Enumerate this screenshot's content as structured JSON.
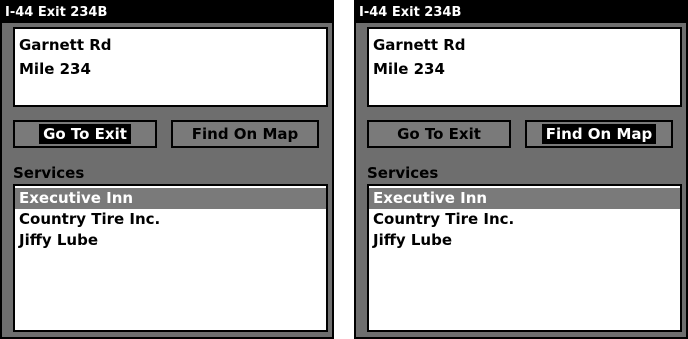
{
  "screens": [
    {
      "title": "I-44 Exit 234B",
      "address_lines": [
        "Garnett Rd",
        "Mile 234"
      ],
      "buttons": {
        "goto_label": "Go To Exit",
        "find_label": "Find On Map",
        "selected": "goto"
      },
      "services_label": "Services",
      "services": [
        "Executive Inn",
        "Country Tire Inc.",
        "Jiffy Lube"
      ],
      "highlighted_service": "Executive Inn"
    },
    {
      "title": "I-44 Exit 234B",
      "address_lines": [
        "Garnett Rd",
        "Mile 234"
      ],
      "buttons": {
        "goto_label": "Go To Exit",
        "find_label": "Find On Map",
        "selected": "find"
      },
      "services_label": "Services",
      "services": [
        "Executive Inn",
        "Country Tire Inc.",
        "Jiffy Lube"
      ],
      "highlighted_service": "Executive Inn"
    }
  ]
}
